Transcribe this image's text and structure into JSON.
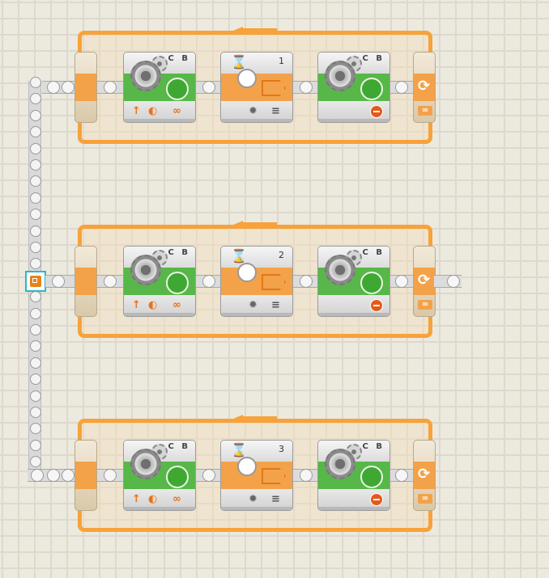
{
  "app": {
    "canvas_description": "LEGO NXT-G program canvas",
    "accent_orange": "#f7a23a",
    "motor_green": "#57b748",
    "start_highlight": "#2bb8c8"
  },
  "icons": {
    "start": "start-point-icon",
    "motor": "motor-gears-icon",
    "sensor": "light-sensor-icon",
    "loop": "loop-arrows-icon",
    "infinity": "infinity-icon",
    "stop": "stop-icon"
  },
  "rows": [
    {
      "loop_end_label": "∞",
      "motor_a": {
        "ports": "C B",
        "icons": [
          "↑",
          "◐",
          "∞"
        ]
      },
      "sensor": {
        "number": "1",
        "icons": [
          "✹",
          "≡"
        ]
      },
      "motor_b": {
        "ports": "C B"
      }
    },
    {
      "loop_end_label": "∞",
      "motor_a": {
        "ports": "C B",
        "icons": [
          "↑",
          "◐",
          "∞"
        ]
      },
      "sensor": {
        "number": "2",
        "icons": [
          "✹",
          "≡"
        ]
      },
      "motor_b": {
        "ports": "C B"
      }
    },
    {
      "loop_end_label": "∞",
      "motor_a": {
        "ports": "C B",
        "icons": [
          "↑",
          "◐",
          "∞"
        ]
      },
      "sensor": {
        "number": "3",
        "icons": [
          "✹",
          "≡"
        ]
      },
      "motor_b": {
        "ports": "C B"
      }
    }
  ]
}
